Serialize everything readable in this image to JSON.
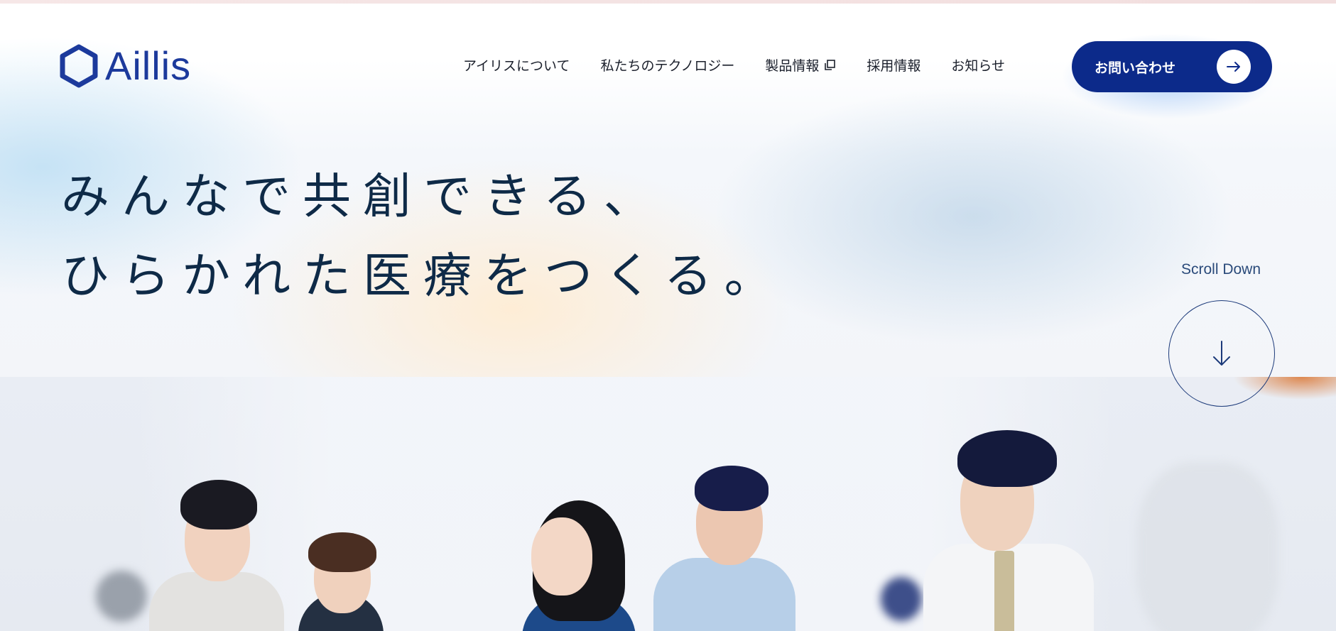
{
  "brand": {
    "logo_text": "Aillis",
    "logo_icon": "hexagon-icon",
    "color": "#1c3a9c"
  },
  "nav": {
    "items": [
      {
        "label": "アイリスについて"
      },
      {
        "label": "私たちのテクノロジー"
      },
      {
        "label": "製品情報",
        "icon": "external-link-icon"
      },
      {
        "label": "採用情報"
      },
      {
        "label": "お知らせ"
      }
    ]
  },
  "contact": {
    "label": "お問い合わせ",
    "icon": "arrow-right-icon",
    "color": "#0c2a8a"
  },
  "hero": {
    "line1": "みんなで共創できる、",
    "line2": "ひらかれた医療をつくる。",
    "text_color": "#0e2a47"
  },
  "scroll": {
    "label": "Scroll Down",
    "icon": "arrow-down-icon"
  }
}
